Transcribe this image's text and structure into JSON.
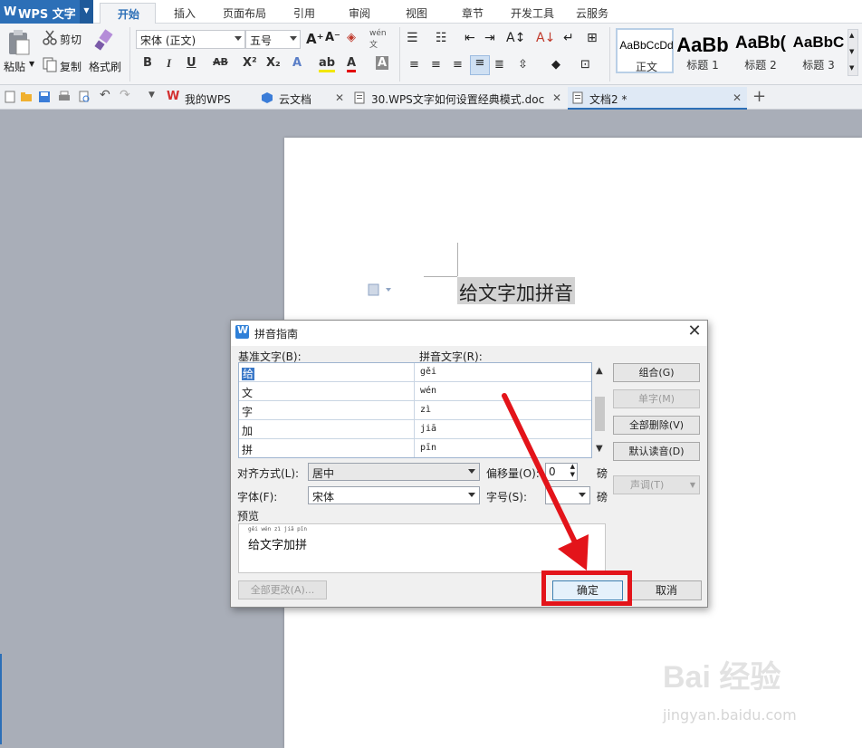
{
  "app": {
    "name": "WPS 文字"
  },
  "menu": [
    "开始",
    "插入",
    "页面布局",
    "引用",
    "审阅",
    "视图",
    "章节",
    "开发工具",
    "云服务"
  ],
  "ribbon": {
    "clipboard": {
      "paste": "粘贴",
      "cut": "剪切",
      "copy": "复制",
      "format_painter": "格式刷"
    },
    "font_name": "宋体 (正文)",
    "font_size": "五号",
    "styles": [
      {
        "sample": "AaBbCcDd",
        "label": "正文"
      },
      {
        "sample": "AaBb",
        "label": "标题 1"
      },
      {
        "sample": "AaBb(",
        "label": "标题 2"
      },
      {
        "sample": "AaBbC",
        "label": "标题 3"
      }
    ]
  },
  "tabs": [
    {
      "label": "我的WPS",
      "icon": "wps-logo-icon"
    },
    {
      "label": "云文档",
      "icon": "cloud-doc-icon"
    },
    {
      "label": "30.WPS文字如何设置经典模式.doc",
      "icon": "word-doc-icon"
    },
    {
      "label": "文档2 *",
      "icon": "word-doc-icon"
    }
  ],
  "document": {
    "selected_text": "给文字加拼音"
  },
  "dialog": {
    "title": "拼音指南",
    "base_text_label": "基准文字(B):",
    "ruby_text_label": "拼音文字(R):",
    "rows": [
      {
        "base": "给",
        "ruby": "gěi"
      },
      {
        "base": "文",
        "ruby": "wén"
      },
      {
        "base": "字",
        "ruby": "zì"
      },
      {
        "base": "加",
        "ruby": "jiā"
      },
      {
        "base": "拼",
        "ruby": "pīn"
      }
    ],
    "buttons": {
      "group": "组合(G)",
      "single": "单字(M)",
      "clear_all": "全部删除(V)",
      "default_reading": "默认读音(D)",
      "tone": "声调(T)",
      "change_all": "全部更改(A)...",
      "ok": "确定",
      "cancel": "取消"
    },
    "align_label": "对齐方式(L):",
    "align_value": "居中",
    "offset_label": "偏移量(O):",
    "offset_value": "0",
    "offset_unit": "磅",
    "font_label": "字体(F):",
    "font_value": "宋体",
    "size_label": "字号(S):",
    "size_value": "",
    "size_unit": "磅",
    "preview_label": "预览",
    "preview_pinyin": "gěi wén zì jiā pīn",
    "preview_text": "给文字加拼"
  },
  "watermark": {
    "brand": "Bai 经验",
    "url": "jingyan.baidu.com"
  },
  "colors": {
    "accent": "#2c6fb7",
    "highlight_red": "#e3141a"
  }
}
